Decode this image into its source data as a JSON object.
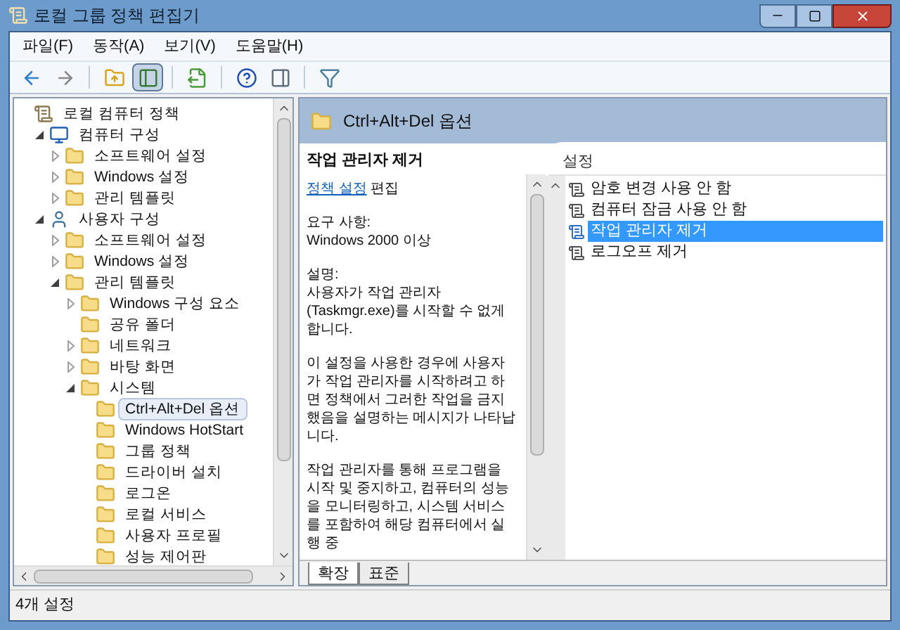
{
  "window": {
    "title": "로컬 그룹 정책 편집기"
  },
  "menu": [
    "파일(F)",
    "동작(A)",
    "보기(V)",
    "도움말(H)"
  ],
  "toolbar": [
    [
      {
        "kind": "back",
        "pressed": false
      },
      {
        "kind": "forward",
        "pressed": false
      }
    ],
    [
      {
        "kind": "up",
        "pressed": false
      },
      {
        "kind": "tree",
        "pressed": true
      }
    ],
    [
      {
        "kind": "export",
        "pressed": false
      }
    ],
    [
      {
        "kind": "help",
        "pressed": false
      },
      {
        "kind": "panel",
        "pressed": false
      }
    ],
    [
      {
        "kind": "filter",
        "pressed": false
      }
    ]
  ],
  "tree": [
    {
      "label": "로컬 컴퓨터 정책",
      "kind": "policy",
      "selected": false,
      "children": [
        {
          "label": "컴퓨터 구성",
          "kind": "computer",
          "expanded": true,
          "selected": false,
          "children": [
            {
              "label": "소프트웨어 설정",
              "kind": "folder",
              "expanded": false,
              "selected": false
            },
            {
              "label": "Windows 설정",
              "kind": "folder",
              "expanded": false,
              "selected": false
            },
            {
              "label": "관리 템플릿",
              "kind": "folder",
              "expanded": false,
              "selected": false
            }
          ]
        },
        {
          "label": "사용자 구성",
          "kind": "user",
          "expanded": true,
          "selected": false,
          "children": [
            {
              "label": "소프트웨어 설정",
              "kind": "folder",
              "expanded": false,
              "selected": false
            },
            {
              "label": "Windows 설정",
              "kind": "folder",
              "expanded": false,
              "selected": false
            },
            {
              "label": "관리 템플릿",
              "kind": "folder",
              "expanded": true,
              "selected": false,
              "children": [
                {
                  "label": "Windows 구성 요소",
                  "kind": "folder",
                  "expanded": false,
                  "selected": false
                },
                {
                  "label": "공유 폴더",
                  "kind": "folder",
                  "selected": false
                },
                {
                  "label": "네트워크",
                  "kind": "folder",
                  "expanded": false,
                  "selected": false
                },
                {
                  "label": "바탕 화면",
                  "kind": "folder",
                  "expanded": false,
                  "selected": false
                },
                {
                  "label": "시스템",
                  "kind": "folder",
                  "expanded": true,
                  "selected": false,
                  "children": [
                    {
                      "label": "Ctrl+Alt+Del 옵션",
                      "kind": "folder",
                      "selected": true
                    },
                    {
                      "label": "Windows HotStart",
                      "kind": "folder",
                      "selected": false
                    },
                    {
                      "label": "그룹 정책",
                      "kind": "folder",
                      "selected": false
                    },
                    {
                      "label": "드라이버 설치",
                      "kind": "folder",
                      "selected": false
                    },
                    {
                      "label": "로그온",
                      "kind": "folder",
                      "selected": false
                    },
                    {
                      "label": "로컬 서비스",
                      "kind": "folder",
                      "selected": false
                    },
                    {
                      "label": "사용자 프로필",
                      "kind": "folder",
                      "selected": false
                    },
                    {
                      "label": "성능 제어판",
                      "kind": "folder",
                      "selected": false
                    }
                  ]
                }
              ]
            }
          ]
        }
      ]
    }
  ],
  "header": {
    "title": "Ctrl+Alt+Del 옵션"
  },
  "description": {
    "title": "작업 관리자 제거",
    "link": "정책 설정",
    "link_suffix": "편집",
    "requirement_label": "요구 사항:",
    "requirement": "Windows 2000 이상",
    "description_label": "설명:",
    "paragraphs": [
      "사용자가 작업 관리자(Taskmgr.exe)를 시작할 수 없게 합니다.",
      "이 설정을 사용한 경우에 사용자가 작업 관리자를 시작하려고 하면 정책에서 그러한 작업을 금지했음을 설명하는 메시지가 나타납니다.",
      "작업 관리자를 통해 프로그램을 시작 및 중지하고, 컴퓨터의 성능을 모니터링하고, 시스템 서비스를 포함하여 해당 컴퓨터에서 실행 중"
    ]
  },
  "settings": {
    "column": "설정",
    "items": [
      {
        "label": "암호 변경 사용 안 함",
        "selected": false
      },
      {
        "label": "컴퓨터 잠금 사용 안 함",
        "selected": false
      },
      {
        "label": "작업 관리자 제거",
        "selected": true
      },
      {
        "label": "로그오프 제거",
        "selected": false
      }
    ]
  },
  "tabs": [
    {
      "label": "확장",
      "selected": true
    },
    {
      "label": "표준",
      "selected": false
    }
  ],
  "status_bar": "4개 설정"
}
